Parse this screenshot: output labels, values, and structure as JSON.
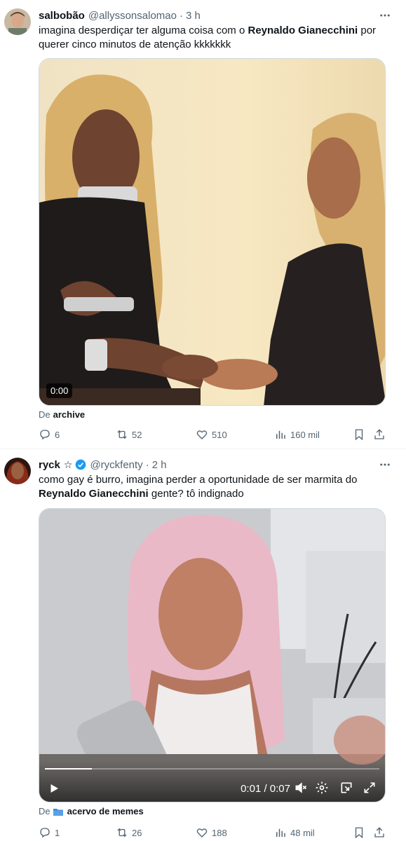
{
  "tweets": [
    {
      "author": {
        "name": "salbobão",
        "handle": "@allyssonsalomao",
        "time": "3 h"
      },
      "text_parts": {
        "a": "imagina desperdiçar ter alguma coisa com o ",
        "b": "Reynaldo Gianecchini",
        "c": " por querer cinco minutos de atenção kkkkkkk"
      },
      "media": {
        "timestamp": "0:00"
      },
      "source": {
        "prefix": "De",
        "name": "archive"
      },
      "stats": {
        "replies": "6",
        "retweets": "52",
        "likes": "510",
        "views": "160 mil"
      }
    },
    {
      "author": {
        "name": "ryck",
        "badge": "☆",
        "handle": "@ryckfenty",
        "time": "2 h"
      },
      "text_parts": {
        "a": "como gay é burro, imagina perder a oportunidade de ser marmita do ",
        "b": "Reynaldo Gianecchini",
        "c": " gente? tô indignado"
      },
      "media": {
        "time_display": "0:01 / 0:07",
        "progress": 0.14
      },
      "source": {
        "prefix": "De",
        "name": "acervo de memes"
      },
      "stats": {
        "replies": "1",
        "retweets": "26",
        "likes": "188",
        "views": "48 mil"
      }
    }
  ],
  "colors": {
    "verified": "#1d9bf0",
    "muted": "#536471",
    "text": "#0f1419"
  }
}
